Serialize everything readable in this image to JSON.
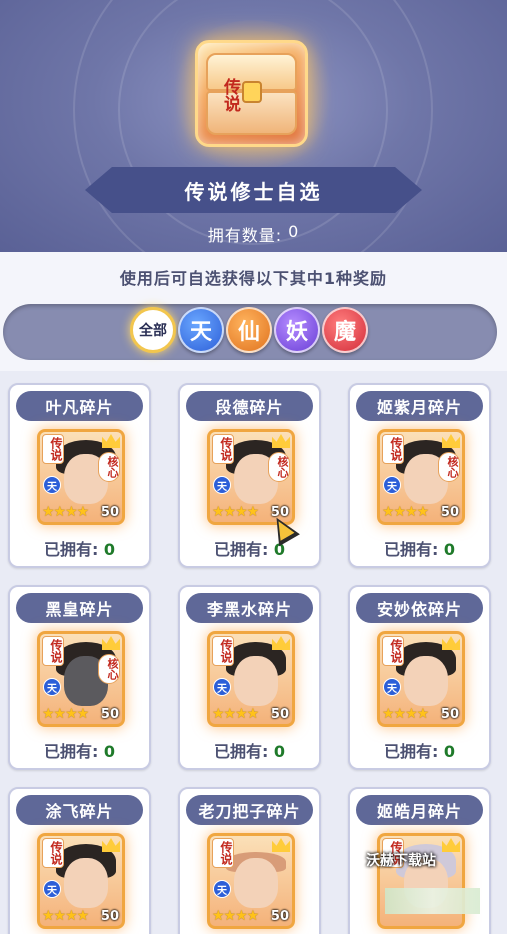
{
  "header": {
    "chest_badge": "传说",
    "title": "传说修士自选",
    "owned_label": "拥有数量:",
    "owned_value": "0"
  },
  "description": "使用后可自选获得以下其中1种奖励",
  "filters": [
    {
      "label": "全部",
      "active": true
    },
    {
      "label": "天",
      "color": "#2d5fd8"
    },
    {
      "label": "仙",
      "color": "#e0731f"
    },
    {
      "label": "妖",
      "color": "#6a3fd6"
    },
    {
      "label": "魔",
      "color": "#d32d3a"
    }
  ],
  "card_common": {
    "legend_tag": "传说",
    "core_tag": "核心",
    "faction": "天",
    "stars": "★★★★",
    "level": "50",
    "owned_label": "已拥有:",
    "owned_value": "0"
  },
  "items": [
    {
      "name": "叶凡碎片"
    },
    {
      "name": "段德碎片"
    },
    {
      "name": "姬紫月碎片"
    },
    {
      "name": "黑皇碎片"
    },
    {
      "name": "李黑水碎片"
    },
    {
      "name": "安妙依碎片"
    },
    {
      "name": "涂飞碎片"
    },
    {
      "name": "老刀把子碎片"
    },
    {
      "name": "姬皓月碎片"
    }
  ],
  "watermark": "沃赫下载站"
}
